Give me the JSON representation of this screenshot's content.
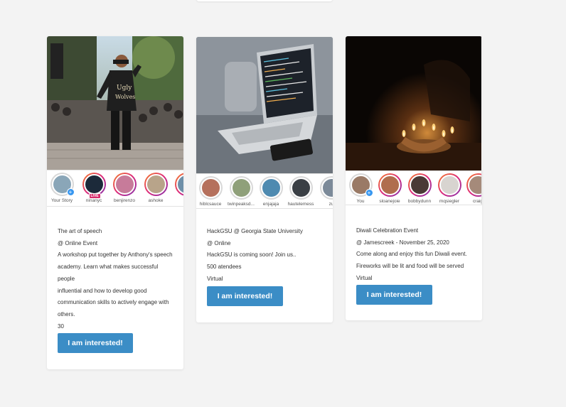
{
  "events": [
    {
      "title": "The art of speech",
      "venue": "@ Online Event",
      "description_lines": [
        "A workshop put together by Anthony's speech",
        "academy. Learn what makes successful people",
        "influential and how to develop good",
        "communication skills to actively engage with",
        "others."
      ],
      "attendees": "30",
      "mode": "Online",
      "cta_label": "I am interested!",
      "photo_icon": "speaker-on-stage-photo",
      "stories": [
        {
          "name": "Your Story",
          "ring": "grey",
          "badge": "plus"
        },
        {
          "name": "ninanyc",
          "ring": "pink",
          "badge": "live",
          "badge_text": "LIVE"
        },
        {
          "name": "benjirenzo",
          "ring": "pink"
        },
        {
          "name": "ashoke",
          "ring": "pink"
        },
        {
          "name": "ia",
          "ring": "pink"
        }
      ]
    },
    {
      "title": "HackGSU @ Georgia State University",
      "venue": "@ Online",
      "description_lines": [
        "HackGSU is coming soon! Join us.."
      ],
      "attendees": "500 atendees",
      "mode": "Virtual",
      "cta_label": "I am interested!",
      "photo_icon": "laptop-on-couch-photo",
      "stories": [
        {
          "name": "hiblcsauce",
          "ring": "grey"
        },
        {
          "name": "twinpeaksd...",
          "ring": "grey"
        },
        {
          "name": "enjajaja",
          "ring": "grey"
        },
        {
          "name": "hautelemess",
          "ring": "grey"
        },
        {
          "name": "zu",
          "ring": "grey"
        }
      ]
    },
    {
      "title": "Diwali Celebration Event",
      "venue": "@ Jamescreek - November 25, 2020",
      "description_lines": [
        "Come along and enjoy this fun Diwali event.",
        "Fireworks will be lit and food will be served"
      ],
      "mode": "Virtual",
      "cta_label": "I am interested!",
      "photo_icon": "diwali-lamps-photo",
      "stories": [
        {
          "name": "You",
          "ring": "grey",
          "badge": "plus"
        },
        {
          "name": "sloanejoie",
          "ring": "pink"
        },
        {
          "name": "bobbydunn",
          "ring": "pink"
        },
        {
          "name": "mqsiegler",
          "ring": "pink"
        },
        {
          "name": "craig",
          "ring": "pink"
        }
      ]
    }
  ],
  "colors": {
    "page_bg": "#f3f3f3",
    "button_bg": "#3b8dc6",
    "story_ring": "#dd2a7b"
  }
}
